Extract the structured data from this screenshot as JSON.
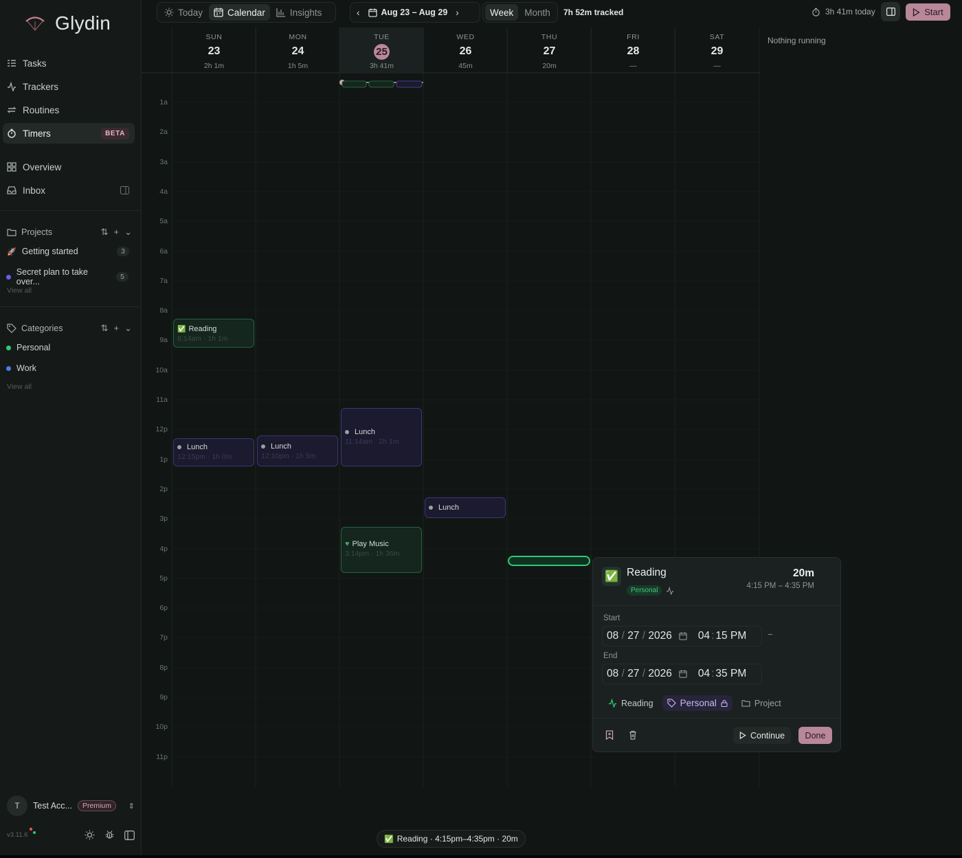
{
  "app": {
    "name": "Glydin",
    "version": "v3.11.6"
  },
  "nav": [
    {
      "label": "Tasks",
      "icon": "tasks-icon"
    },
    {
      "label": "Trackers",
      "icon": "activity-icon"
    },
    {
      "label": "Routines",
      "icon": "repeat-icon"
    },
    {
      "label": "Timers",
      "icon": "stopwatch-icon",
      "badge": "BETA",
      "active": true
    },
    {
      "label": "Overview",
      "icon": "grid-icon"
    },
    {
      "label": "Inbox",
      "icon": "inbox-icon"
    }
  ],
  "projects": {
    "title": "Projects",
    "items": [
      {
        "label": "Getting started",
        "count": "3",
        "icon": "rocket-icon"
      },
      {
        "label": "Secret plan to take over...",
        "count": "5",
        "color": "#6a5cf0"
      }
    ],
    "view_all": "View all"
  },
  "categories": {
    "title": "Categories",
    "items": [
      {
        "label": "Personal",
        "color": "#2ecc71"
      },
      {
        "label": "Work",
        "color": "#4a7cf0"
      }
    ],
    "view_all": "View all"
  },
  "account": {
    "initial": "T",
    "name": "Test Acc...",
    "plan": "Premium"
  },
  "topbar": {
    "tabs": [
      {
        "label": "Today",
        "icon": "sun-icon"
      },
      {
        "label": "Calendar",
        "icon": "calendar-icon",
        "active": true
      },
      {
        "label": "Insights",
        "icon": "bar-chart-icon"
      }
    ],
    "range": "Aug 23 – Aug 29",
    "views": [
      "Week",
      "Month"
    ],
    "tracked": "7h 52m tracked",
    "today_time": "3h 41m today",
    "start": "Start"
  },
  "days": [
    {
      "name": "SUN",
      "num": "23",
      "total": "2h 1m"
    },
    {
      "name": "MON",
      "num": "24",
      "total": "1h 5m"
    },
    {
      "name": "TUE",
      "num": "25",
      "total": "3h 41m",
      "today": true
    },
    {
      "name": "WED",
      "num": "26",
      "total": "45m"
    },
    {
      "name": "THU",
      "num": "27",
      "total": "20m"
    },
    {
      "name": "FRI",
      "num": "28",
      "total": "—"
    },
    {
      "name": "SAT",
      "num": "29",
      "total": "—"
    }
  ],
  "hours": [
    "1a",
    "2a",
    "3a",
    "4a",
    "5a",
    "6a",
    "7a",
    "8a",
    "9a",
    "10a",
    "11a",
    "12p",
    "1p",
    "2p",
    "3p",
    "4p",
    "5p",
    "6p",
    "7p",
    "8p",
    "9p",
    "10p",
    "11p"
  ],
  "events": {
    "sun_reading": {
      "title": "Reading",
      "sub": "8:14am · 1h 1m"
    },
    "sun_lunch": {
      "title": "Lunch",
      "sub": "12:15pm · 1h 0m"
    },
    "mon_lunch": {
      "title": "Lunch",
      "sub": "12:10pm · 1h 5m"
    },
    "tue_lunch": {
      "title": "Lunch",
      "sub": "11:14am · 2h 1m"
    },
    "tue_music": {
      "title": "Play Music",
      "sub": "3:14pm · 1h 36m"
    },
    "wed_lunch": {
      "title": "Lunch"
    }
  },
  "side_panel": {
    "nothing": "Nothing running"
  },
  "popover": {
    "title": "Reading",
    "category": "Personal",
    "duration": "20m",
    "range": "4:15 PM – 4:35 PM",
    "start_label": "Start",
    "end_label": "End",
    "start": {
      "mm": "08",
      "dd": "27",
      "yyyy": "2026",
      "hh": "04",
      "min": "15",
      "ampm": "PM"
    },
    "end": {
      "mm": "08",
      "dd": "27",
      "yyyy": "2026",
      "hh": "04",
      "min": "35",
      "ampm": "PM"
    },
    "tracker": "Reading",
    "category_chip": "Personal",
    "project": "Project",
    "continue": "Continue",
    "done": "Done"
  },
  "toast": "Reading · 4:15pm–4:35pm · 20m",
  "colors": {
    "accent": "#b9879a",
    "green": "#2ecc71",
    "purple": "#6a5cf0"
  }
}
